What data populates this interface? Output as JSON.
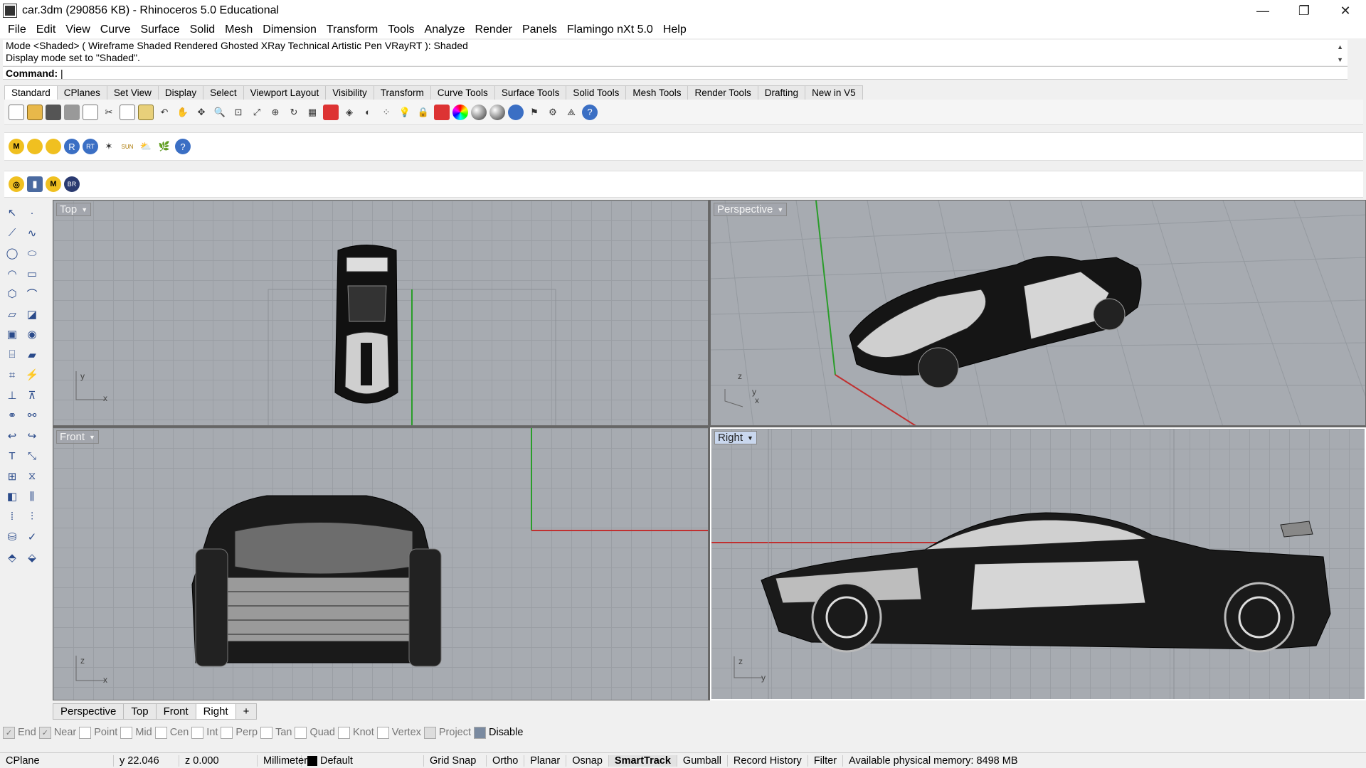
{
  "window": {
    "title": "car.3dm (290856 KB) - Rhinoceros 5.0 Educational",
    "minimize": "—",
    "maximize": "❐",
    "close": "✕"
  },
  "menu": [
    "File",
    "Edit",
    "View",
    "Curve",
    "Surface",
    "Solid",
    "Mesh",
    "Dimension",
    "Transform",
    "Tools",
    "Analyze",
    "Render",
    "Panels",
    "Flamingo nXt 5.0",
    "Help"
  ],
  "history": {
    "line1": "Mode <Shaded> ( Wireframe  Shaded  Rendered  Ghosted  XRay  Technical  Artistic  Pen  VRayRT ): Shaded",
    "line2": "Display mode set to \"Shaded\"."
  },
  "command": {
    "label": "Command:",
    "value": ""
  },
  "toolbar_tabs": [
    "Standard",
    "CPlanes",
    "Set View",
    "Display",
    "Select",
    "Viewport Layout",
    "Visibility",
    "Transform",
    "Curve Tools",
    "Surface Tools",
    "Solid Tools",
    "Mesh Tools",
    "Render Tools",
    "Drafting",
    "New in V5"
  ],
  "active_tab": "Standard",
  "plugin_icons": {
    "m": "M",
    "r": "R",
    "rt": "RT",
    "sun": "SUN",
    "br": "BR",
    "help": "?"
  },
  "viewports": {
    "top": {
      "title": "Top",
      "axis1": "y",
      "axis2": "x"
    },
    "perspective": {
      "title": "Perspective",
      "axis1": "z",
      "axis2": "y",
      "axis3": "x"
    },
    "front": {
      "title": "Front",
      "axis1": "z",
      "axis2": "x"
    },
    "right": {
      "title": "Right",
      "axis1": "z",
      "axis2": "y"
    }
  },
  "viewport_tabs": [
    "Perspective",
    "Top",
    "Front",
    "Right"
  ],
  "viewport_tab_add": "+",
  "osnaps": [
    {
      "label": "End",
      "checked": true
    },
    {
      "label": "Near",
      "checked": true
    },
    {
      "label": "Point",
      "checked": false
    },
    {
      "label": "Mid",
      "checked": false
    },
    {
      "label": "Cen",
      "checked": false
    },
    {
      "label": "Int",
      "checked": false
    },
    {
      "label": "Perp",
      "checked": false
    },
    {
      "label": "Tan",
      "checked": false
    },
    {
      "label": "Quad",
      "checked": false
    },
    {
      "label": "Knot",
      "checked": false
    },
    {
      "label": "Vertex",
      "checked": false
    },
    {
      "label": "Project",
      "checked": false
    },
    {
      "label": "Disable",
      "checked": false
    }
  ],
  "status": {
    "cplane": "CPlane",
    "y": "y 22.046",
    "z": "z 0.000",
    "units": "Millimeters",
    "layer": "Default",
    "grid_snap": "Grid Snap",
    "ortho": "Ortho",
    "planar": "Planar",
    "osnap": "Osnap",
    "smarttrack": "SmartTrack",
    "gumball": "Gumball",
    "record_history": "Record History",
    "filter": "Filter",
    "memory": "Available physical memory: 8498 MB"
  }
}
